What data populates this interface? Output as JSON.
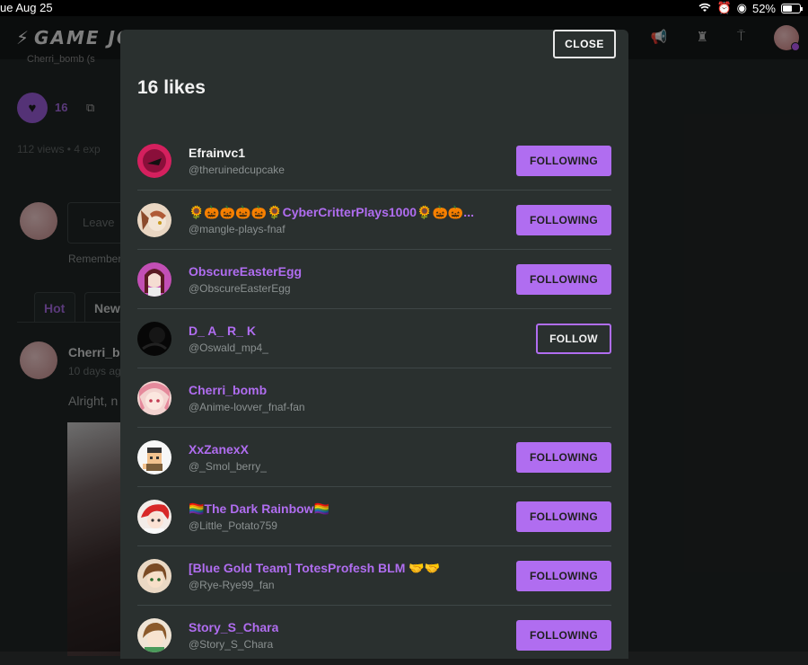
{
  "status_bar": {
    "time": "ue Aug 25",
    "battery": "52%"
  },
  "background": {
    "logo": "GAME JO",
    "crumb": "Cherri_bomb (s",
    "like_count": "16",
    "views": "112 views   •   4 exp",
    "comment_placeholder": "Leave",
    "remember": "Remember",
    "tabs": [
      "Hot",
      "New"
    ],
    "post_author": "Cherri_bo",
    "post_time": "10 days ag",
    "post_text": "Alright, n"
  },
  "modal": {
    "close_label": "CLOSE",
    "title": "16 likes",
    "users": [
      {
        "name": "Efrainvc1",
        "handle": "@theruinedcupcake",
        "button": "FOLLOWING",
        "following": true,
        "avatar": "magenta"
      },
      {
        "name": "🌻🎃🎃🎃🎃🌻CyberCritterPlays1000🌻🎃🎃...",
        "handle": "@mangle-plays-fnaf",
        "button": "FOLLOWING",
        "following": true,
        "avatar": "fox"
      },
      {
        "name": "ObscureEasterEgg",
        "handle": "@ObscureEasterEgg",
        "button": "FOLLOWING",
        "following": true,
        "avatar": "purple"
      },
      {
        "name": "D_ A_ R_ K",
        "handle": "@Oswald_mp4_",
        "button": "FOLLOW",
        "following": false,
        "avatar": "dark"
      },
      {
        "name": "Cherri_bomb",
        "handle": "@Anime-lovver_fnaf-fan",
        "button": "",
        "following": null,
        "avatar": "pink"
      },
      {
        "name": "XxZanexX",
        "handle": "@_Smol_berry_",
        "button": "FOLLOWING",
        "following": true,
        "avatar": "white"
      },
      {
        "name": "🏳️‍🌈The Dark Rainbow🏳️‍🌈",
        "handle": "@Little_Potato759",
        "button": "FOLLOWING",
        "following": true,
        "avatar": "red"
      },
      {
        "name": "[Blue Gold Team] TotesProfesh BLM 🤝🤝",
        "handle": "@Rye-Rye99_fan",
        "button": "FOLLOWING",
        "following": true,
        "avatar": "brown"
      },
      {
        "name": "Story_S_Chara",
        "handle": "@Story_S_Chara",
        "button": "FOLLOWING",
        "following": true,
        "avatar": "tan"
      }
    ]
  },
  "colors": {
    "accent": "#b06df0",
    "modal_bg": "#2a302f",
    "page_bg": "#202525"
  }
}
